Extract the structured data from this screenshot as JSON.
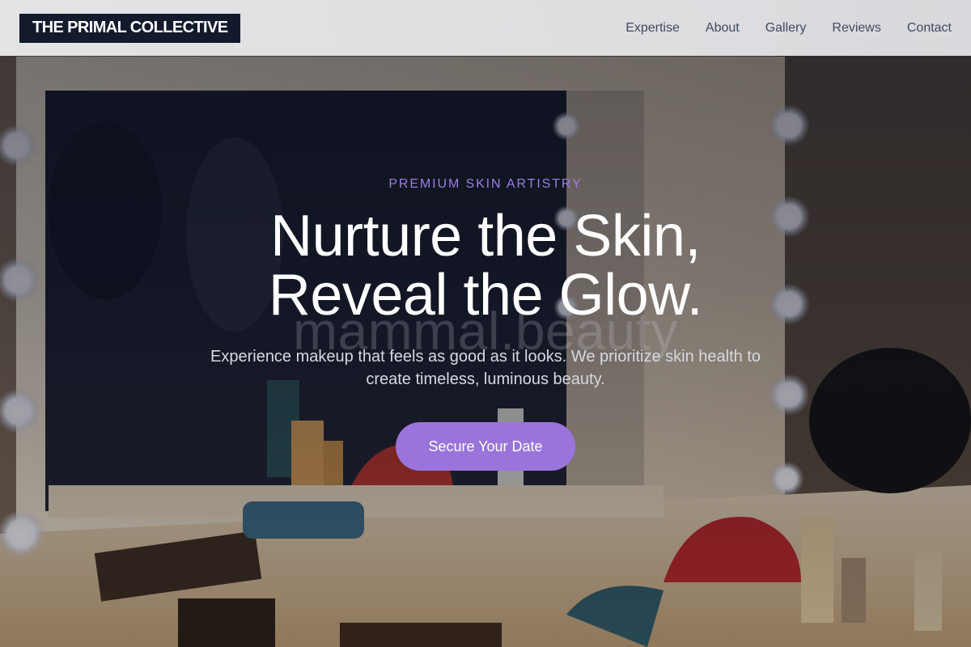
{
  "header": {
    "brand": "THE PRIMAL COLLECTIVE",
    "nav": [
      {
        "label": "Expertise"
      },
      {
        "label": "About"
      },
      {
        "label": "Gallery"
      },
      {
        "label": "Reviews"
      },
      {
        "label": "Contact"
      }
    ]
  },
  "hero": {
    "eyebrow": "PREMIUM SKIN ARTISTRY",
    "headline_line1": "Nurture the Skin,",
    "headline_line2": "Reveal the Glow.",
    "watermark": "mammal.beauty",
    "subtitle": "Experience makeup that feels as good as it looks. We prioritize skin health to create timeless, luminous beauty.",
    "cta_label": "Secure Your Date"
  },
  "colors": {
    "brand_bg": "#121a2c",
    "accent": "#9a74da",
    "eyebrow": "#9b7fe0"
  }
}
